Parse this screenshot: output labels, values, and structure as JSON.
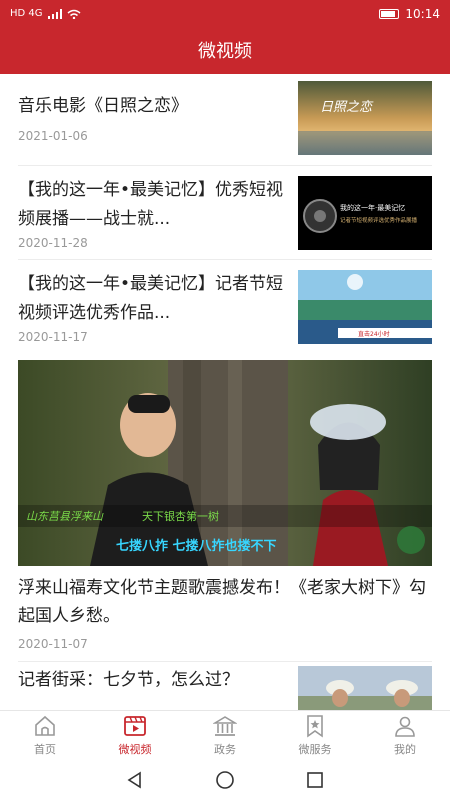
{
  "status": {
    "signal_text": "HD 4G",
    "time": "10:14",
    "battery": "82"
  },
  "header": {
    "title": "微视频"
  },
  "items": [
    {
      "title": "音乐电影《日照之恋》",
      "date": "2021-01-06"
    },
    {
      "title": "【我的这一年•最美记忆】优秀短视频展播——战士就...",
      "date": "2020-11-28"
    },
    {
      "title": "【我的这一年•最美记忆】记者节短视频评选优秀作品...",
      "date": "2020-11-17"
    }
  ],
  "big_item": {
    "title": "浮来山福寿文化节主题歌震撼发布！《老家大树下》勾起国人乡愁。",
    "date": "2020-11-07",
    "overlay": {
      "caption_left": "山东莒县浮来山",
      "caption_right": "天下银杏第一树",
      "subtitle": "七搂八拃 七搂八拃也搂不下"
    }
  },
  "partial_item": {
    "title": "记者街采：七夕节，怎么过？"
  },
  "thumb_text": {
    "t1": "日照之恋",
    "t2_line1": "我的这一年·最美记忆",
    "t2_line2": "记者节短视频评选优秀作品展播",
    "t3_banner": "直击24小时"
  },
  "tabs": [
    {
      "label": "首页",
      "icon": "home-icon"
    },
    {
      "label": "微视频",
      "icon": "video-icon"
    },
    {
      "label": "政务",
      "icon": "government-icon"
    },
    {
      "label": "微服务",
      "icon": "service-icon"
    },
    {
      "label": "我的",
      "icon": "user-icon"
    }
  ],
  "colors": {
    "brand": "#c8272d",
    "inactive": "#888888"
  }
}
